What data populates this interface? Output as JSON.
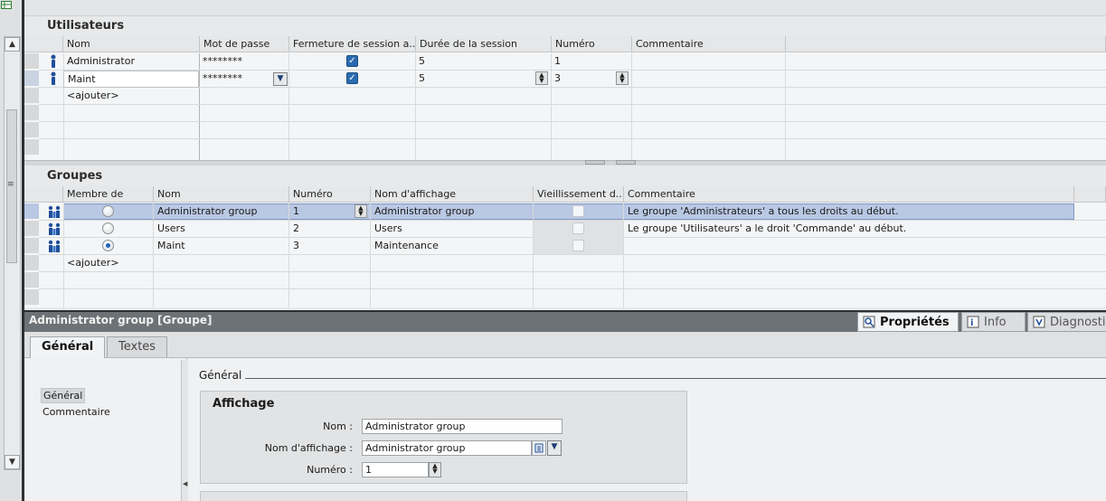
{
  "users": {
    "title": "Utilisateurs",
    "columns": [
      "Nom",
      "Mot de passe",
      "Fermeture  de  session a..",
      "Durée de la session",
      "Numéro",
      "Commentaire"
    ],
    "rows": [
      {
        "name": "Administrator",
        "password": "********",
        "logoff": true,
        "duration": "5",
        "number": "1",
        "comment": ""
      },
      {
        "name": "Maint",
        "password": "********",
        "logoff": true,
        "duration": "5",
        "number": "3",
        "comment": ""
      }
    ],
    "add_label": "<ajouter>"
  },
  "groups": {
    "title": "Groupes",
    "columns": [
      "Membre de",
      "Nom",
      "Numéro",
      "Nom d'affichage",
      "Vieillissement d..",
      "Commentaire"
    ],
    "rows": [
      {
        "member": false,
        "name": "Administrator group",
        "number": "1",
        "display": "Administrator group",
        "comment": "Le groupe 'Administrateurs' a tous les droits au début."
      },
      {
        "member": false,
        "name": "Users",
        "number": "2",
        "display": "Users",
        "comment": "Le groupe 'Utilisateurs' a le droit 'Commande' au début."
      },
      {
        "member": true,
        "name": "Maint",
        "number": "3",
        "display": "Maintenance",
        "comment": ""
      }
    ],
    "add_label": "<ajouter>"
  },
  "inspector": {
    "title": "Administrator group [Groupe]",
    "tabs": {
      "properties": "Propriétés",
      "info": "Info",
      "diagnostics": "Diagnosti"
    },
    "subtabs": {
      "general": "Général",
      "texts": "Textes"
    },
    "nav": {
      "general": "Général",
      "comment": "Commentaire"
    },
    "section_header": "Général",
    "display_group": {
      "title": "Affichage",
      "name_label": "Nom :",
      "name_value": "Administrator group",
      "display_label": "Nom d'affichage :",
      "display_value": "Administrator group",
      "number_label": "Numéro :",
      "number_value": "1"
    }
  },
  "colors": {
    "selection": "#b9c8e3",
    "title_bar": "#6d7276",
    "check": "#2b6cb0"
  }
}
